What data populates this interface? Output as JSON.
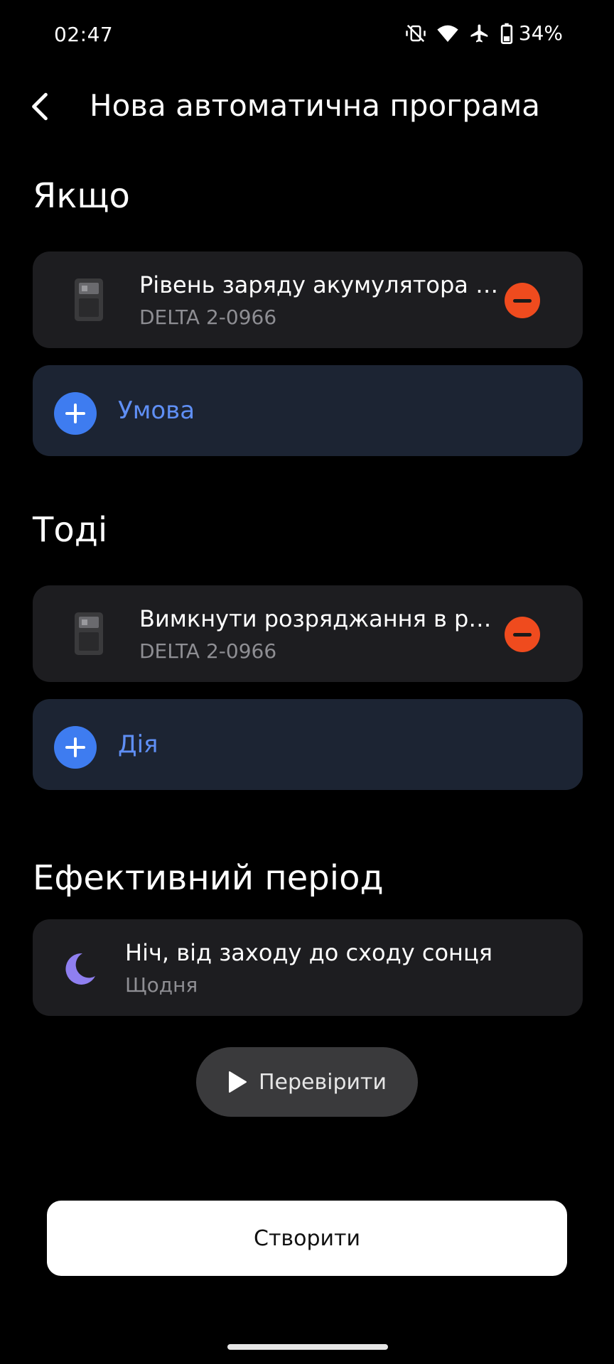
{
  "status_bar": {
    "time": "02:47",
    "battery": "34%",
    "icons": [
      "vibrate-off-icon",
      "wifi-icon",
      "airplane-icon",
      "battery-icon"
    ]
  },
  "header": {
    "title": "Нова автоматична програма",
    "back_icon": "chevron-left-icon"
  },
  "if_section": {
    "title": "Якщо",
    "item": {
      "title": "Рівень заряду акумулятора на пристрої",
      "subtitle": "DELTA 2-0966"
    },
    "add_label": "Умова"
  },
  "then_section": {
    "title": "Тоді",
    "item": {
      "title": "Вимкнути розряджання в режимі",
      "subtitle": "DELTA 2-0966"
    },
    "add_label": "Дія"
  },
  "period_section": {
    "title": "Ефективний період",
    "item": {
      "title": "Ніч, від заходу до сходу сонця",
      "subtitle": "Щодня"
    }
  },
  "test_button": {
    "label": "Перевірити"
  },
  "create_button": {
    "label": "Створити"
  },
  "colors": {
    "accent": "#3e7cf0",
    "remove": "#ef4b1e",
    "card": "#1d1d20",
    "add_card": "#1c2433",
    "moon": "#8f7ff0"
  }
}
